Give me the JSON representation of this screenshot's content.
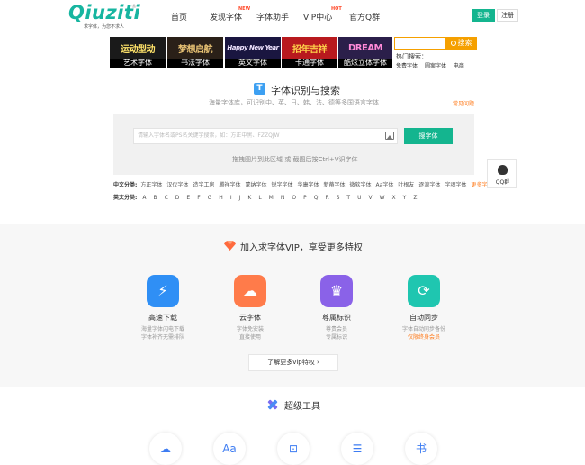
{
  "header": {
    "logo_text": "Qiuziti",
    "logo_sub": "求字体，为您不求人",
    "logo_reg": "®",
    "nav": [
      {
        "label": "首页",
        "tag": ""
      },
      {
        "label": "发现字体",
        "tag": "NEW"
      },
      {
        "label": "字体助手",
        "tag": ""
      },
      {
        "label": "VIP中心",
        "tag": "HOT"
      },
      {
        "label": "官方Q群",
        "tag": ""
      }
    ],
    "login": "登录",
    "register": "注册"
  },
  "banners": [
    {
      "art": "运动型动",
      "caption": "艺术字体",
      "bg": "#1a1a1a",
      "color": "#ffe36a"
    },
    {
      "art": "梦想启航",
      "caption": "书法字体",
      "bg": "#2a2018",
      "color": "#e8c274"
    },
    {
      "art": "Happy New Year",
      "caption": "英文字体",
      "bg": "#1a1640",
      "color": "#f0e4ff"
    },
    {
      "art": "招年吉祥",
      "caption": "卡通字体",
      "bg": "#b8191e",
      "color": "#ffd24a"
    },
    {
      "art": "DREAM",
      "caption": "酷炫立体字体",
      "bg": "#2b1f4a",
      "color": "#ff8ad8"
    }
  ],
  "mini_search": {
    "button": "搜索"
  },
  "hot": {
    "label": "热门搜索：",
    "links": [
      "免费字体",
      "圆案字体",
      "电商"
    ]
  },
  "search": {
    "title": "字体识别与搜索",
    "title_icon": "T",
    "subtitle": "海量字体库，可识别中、英、日、韩、法、德等多国语言字体",
    "faq": "常见问题",
    "placeholder": "请输入字体名或PS名关键字搜索，如：方正中黑、FZZQJW",
    "button": "搜字体",
    "drag_hint": "拖拽图片到此区域 或 截图后按Ctrl+V识字体"
  },
  "categories": {
    "cn_label": "中文分类:",
    "cn": [
      "方正字体",
      "汉仪字体",
      "造字工房",
      "腾祥字体",
      "蒙纳字体",
      "锐字字体",
      "华康字体",
      "新蒂字体",
      "微软字体",
      "Aa字体",
      "叶根友",
      "逐浪字体",
      "字魂字体"
    ],
    "cn_more": "更多字体",
    "en_label": "英文分类:",
    "en": [
      "A",
      "B",
      "C",
      "D",
      "E",
      "F",
      "G",
      "H",
      "I",
      "J",
      "K",
      "L",
      "M",
      "N",
      "O",
      "P",
      "Q",
      "R",
      "S",
      "T",
      "U",
      "V",
      "W",
      "X",
      "Y",
      "Z"
    ]
  },
  "qq": {
    "label": "QQ群"
  },
  "vip": {
    "title": "加入求字体VIP，享受更多特权",
    "features": [
      {
        "name": "高速下载",
        "d1": "海量字体闪电下载",
        "d2": "字体补齐无需排队",
        "color": "#2f8ff5",
        "icon": "⚡",
        "d2_highlight": false
      },
      {
        "name": "云字体",
        "d1": "字体免安装",
        "d2": "直接使用",
        "color": "#ff7b4a",
        "icon": "☁",
        "d2_highlight": false
      },
      {
        "name": "尊属标识",
        "d1": "尊贵会员",
        "d2": "专属标识",
        "color": "#8a62e8",
        "icon": "♛",
        "d2_highlight": false
      },
      {
        "name": "自动同步",
        "d1": "字体自动同步备份",
        "d2": "仅限终身会员",
        "color": "#1fc6b0",
        "icon": "⟳",
        "d2_highlight": true
      }
    ],
    "more": "了解更多vip特权  ›"
  },
  "tools": {
    "title": "超级工具",
    "items": [
      "☁",
      "Aa",
      "⊡",
      "☰",
      "书"
    ]
  }
}
